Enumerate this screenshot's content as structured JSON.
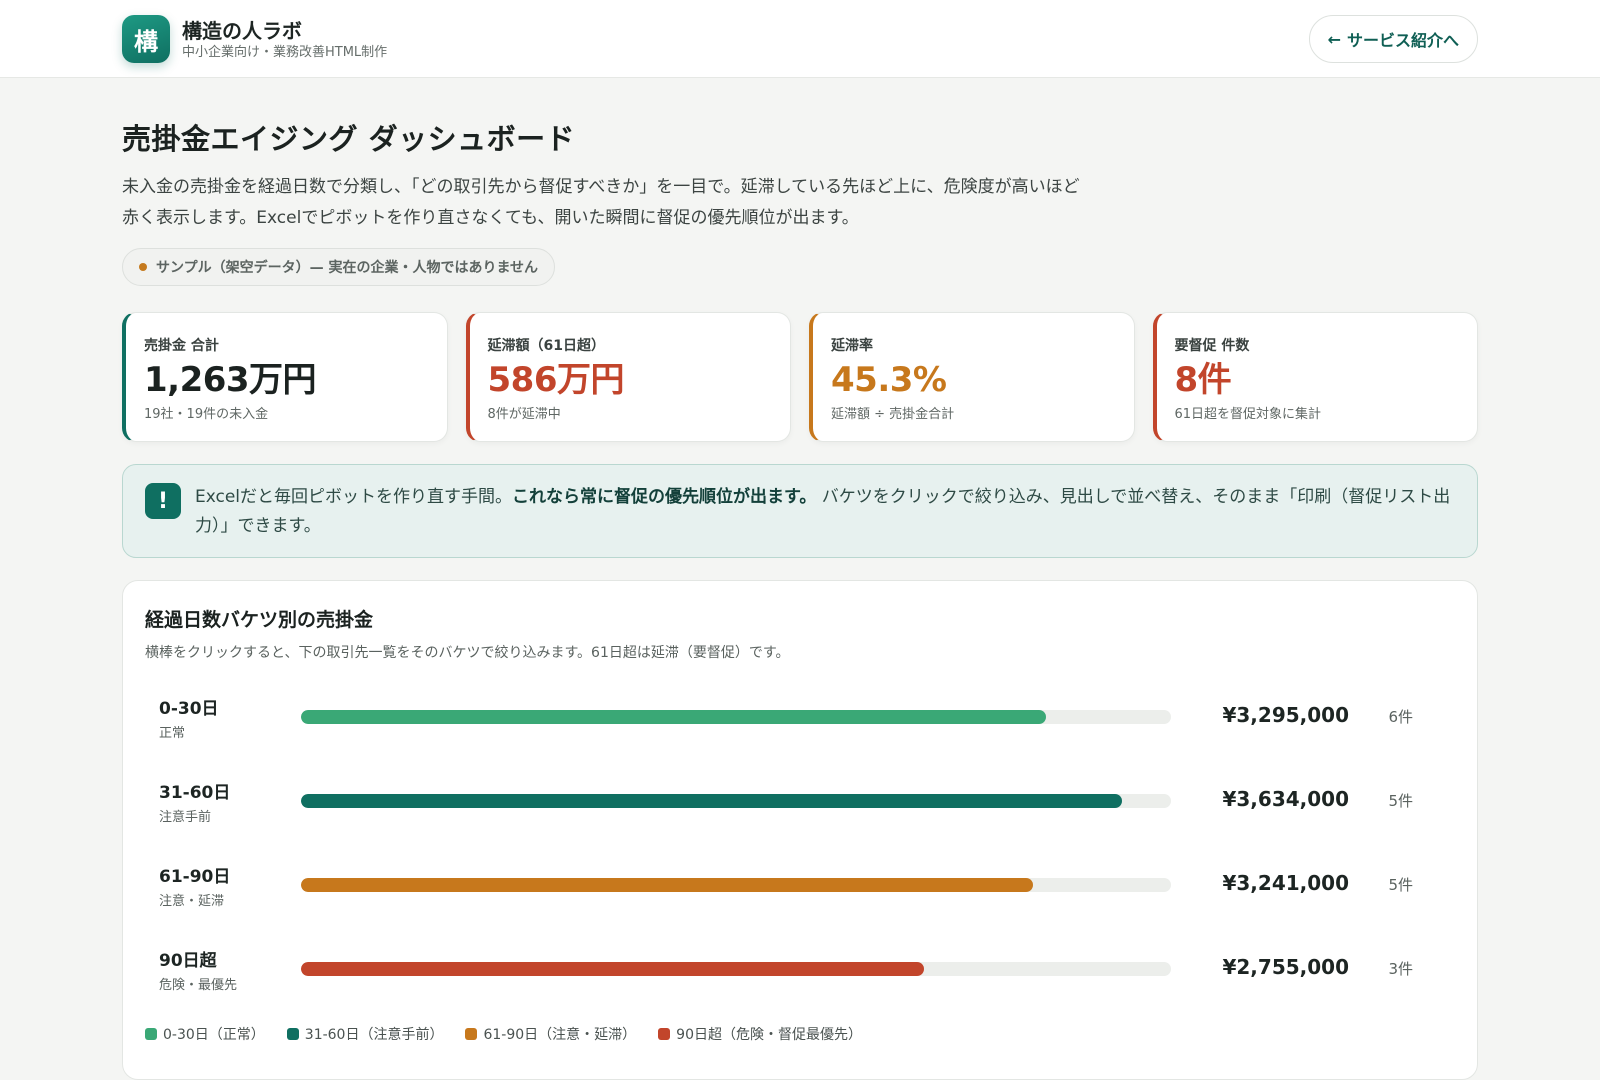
{
  "header": {
    "logo_char": "構",
    "brand_name": "構造の人ラボ",
    "brand_sub": "中小企業向け・業務改善HTML制作",
    "back_arrow": "←",
    "back_label": "サービス紹介へ"
  },
  "page": {
    "title": "売掛金エイジング ダッシュボード",
    "description": "未入金の売掛金を経過日数で分類し、「どの取引先から督促すべきか」を一目で。延滞している先ほど上に、危険度が高いほど赤く表示します。Excelでピボットを作り直さなくても、開いた瞬間に督促の優先順位が出ます。",
    "sample_badge": "サンプル（架空データ）— 実在の企業・人物ではありません"
  },
  "kpis": [
    {
      "label": "売掛金 合計",
      "value": "1,263万円",
      "note": "19社・19件の未入金"
    },
    {
      "label": "延滞額（61日超）",
      "value": "586万円",
      "note": "8件が延滞中"
    },
    {
      "label": "延滞率",
      "value": "45.3%",
      "note": "延滞額 ÷ 売掛金合計"
    },
    {
      "label": "要督促 件数",
      "value": "8件",
      "note": "61日超を督促対象に集計"
    }
  ],
  "notice": {
    "icon": "!",
    "text_before": "Excelだと毎回ピボットを作り直す手間。",
    "text_bold": "これなら常に督促の優先順位が出ます。",
    "text_after": " バケツをクリックで絞り込み、見出しで並べ替え、そのまま「印刷（督促リスト出力）」できます。"
  },
  "chart_panel": {
    "title": "経過日数バケツ別の売掛金",
    "subtitle": "横棒をクリックすると、下の取引先一覧をそのバケツで絞り込みます。61日超は延滞（要督促）です。"
  },
  "chart_data": {
    "type": "bar",
    "orientation": "horizontal",
    "categories": [
      "0-30日",
      "31-60日",
      "61-90日",
      "90日超"
    ],
    "category_notes": [
      "正常",
      "注意手前",
      "注意・延滞",
      "危険・最優先"
    ],
    "values": [
      3295000,
      3634000,
      3241000,
      2755000
    ],
    "value_labels": [
      "¥3,295,000",
      "¥3,634,000",
      "¥3,241,000",
      "¥2,755,000"
    ],
    "counts": [
      "6件",
      "5件",
      "5件",
      "3件"
    ],
    "xlim": [
      0,
      3850000
    ],
    "colors": [
      "#3aa876",
      "#0f6f61",
      "#c7781c",
      "#c2452b"
    ],
    "legend": [
      "0-30日（正常）",
      "31-60日（注意手前）",
      "61-90日（注意・延滞）",
      "90日超（危険・督促最優先）"
    ],
    "legend_placement": "bottom-left"
  }
}
